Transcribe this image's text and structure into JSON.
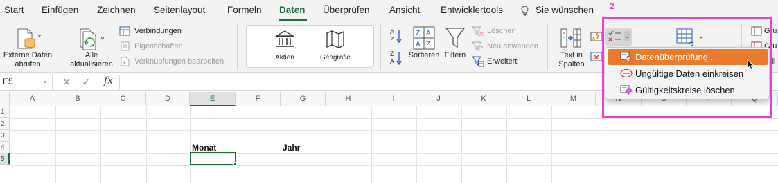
{
  "tabs": [
    "Start",
    "Einfügen",
    "Zeichnen",
    "Seitenlayout",
    "Formeln",
    "Daten",
    "Überprüfen",
    "Ansicht",
    "Entwicklertools",
    "Sie wünschen"
  ],
  "active_tab": "Daten",
  "step_number": "2",
  "ribbon": {
    "external_data_label_1": "Externe Daten",
    "external_data_label_2": "abrufen",
    "refresh_all_1": "Alle",
    "refresh_all_2": "aktualisieren",
    "connections": "Verbindungen",
    "properties": "Eigenschaften",
    "edit_links": "Verknüpfungen bearbeiten",
    "stocks": "Aktien",
    "geography": "Geografie",
    "sort": "Sortieren",
    "filter": "Filtern",
    "clear": "Löschen",
    "reapply": "Neu anwenden",
    "advanced": "Erweitert",
    "text_to_columns_1": "Text in",
    "text_to_columns_2": "Spalten",
    "group_1": "Gru",
    "group_2": "Gru",
    "group_3": "Teil"
  },
  "formula_bar": {
    "name_box": "E5",
    "cancel": "✕",
    "enter": "✓",
    "fx": "fx",
    "content": ""
  },
  "columns": [
    "A",
    "B",
    "C",
    "D",
    "E",
    "F",
    "G",
    "H",
    "I",
    "J",
    "K",
    "L",
    "M",
    "N",
    "O",
    "P",
    "Q"
  ],
  "rows": [
    "1",
    "2",
    "3",
    "4",
    "5"
  ],
  "cells": {
    "E4": "Monat",
    "G4": "Jahr"
  },
  "selected_cell": "E5",
  "menu": {
    "items": [
      "Datenüberprüfung...",
      "Ungültige Daten einkreisen",
      "Gültigkeitskreise löschen"
    ],
    "highlighted_index": 0
  },
  "colors": {
    "accent_green": "#1e6e3a",
    "highlight_magenta": "#e83fd9",
    "menu_highlight": "#ea7a2c"
  }
}
